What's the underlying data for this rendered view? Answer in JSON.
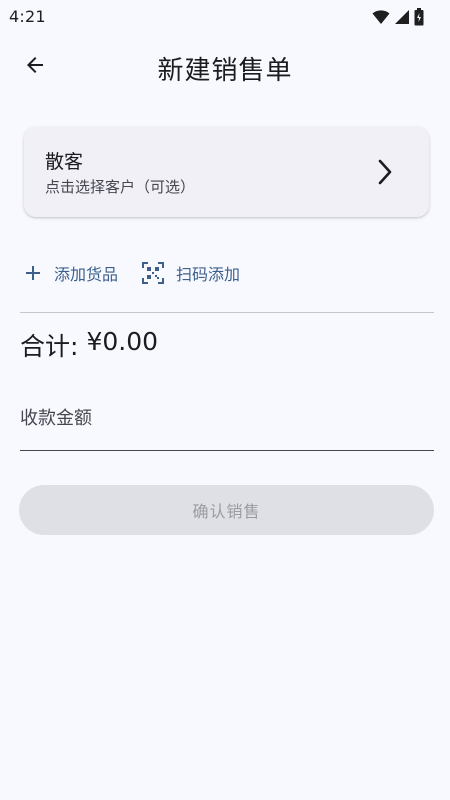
{
  "status_bar": {
    "time": "4:21"
  },
  "app_bar": {
    "title": "新建销售单",
    "back_icon": "arrow-back-icon"
  },
  "customer": {
    "name": "散客",
    "hint": "点击选择客户（可选）"
  },
  "actions": {
    "add_goods": "添加货品",
    "scan_add": "扫码添加"
  },
  "summary": {
    "total_label": "合计:",
    "total_value": "¥0.00"
  },
  "payment": {
    "label": "收款金额",
    "value": ""
  },
  "confirm": {
    "label": "确认销售"
  },
  "colors": {
    "accent": "#3c5f8c",
    "background": "#f8f9fe",
    "disabled_button": "#dfe0e5"
  }
}
